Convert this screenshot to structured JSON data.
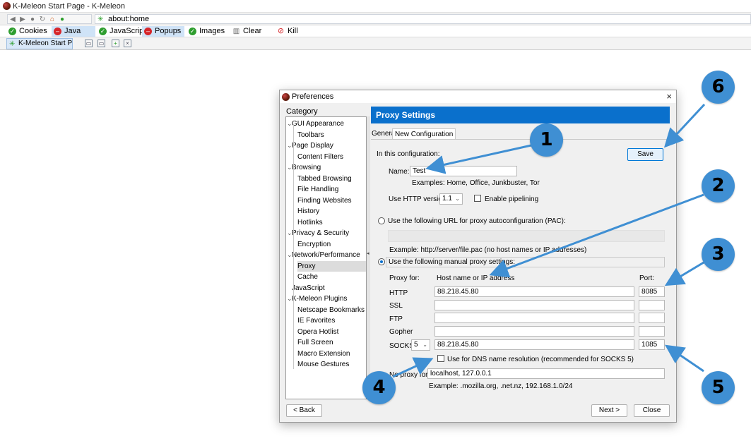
{
  "window": {
    "title": "K-Meleon Start Page - K-Meleon"
  },
  "navbar": {
    "url": "about:home"
  },
  "toggles": [
    {
      "label": "Cookies",
      "state": "on"
    },
    {
      "label": "Java",
      "state": "off"
    },
    {
      "label": "JavaScript",
      "state": "on"
    },
    {
      "label": "Popups",
      "state": "off"
    },
    {
      "label": "Images",
      "state": "on"
    },
    {
      "label": "Clear Cache",
      "state": "action"
    },
    {
      "label": "Kill Flash",
      "state": "action"
    }
  ],
  "tabs": [
    {
      "label": "K-Meleon Start Pa..."
    }
  ],
  "dialog": {
    "title": "Preferences",
    "close": "×",
    "category_label": "Category",
    "categories": [
      {
        "label": "GUI Appearance",
        "level": 0,
        "expander": true
      },
      {
        "label": "Toolbars",
        "level": 1
      },
      {
        "label": "Page Display",
        "level": 0,
        "expander": true
      },
      {
        "label": "Content Filters",
        "level": 1
      },
      {
        "label": "Browsing",
        "level": 0,
        "expander": true
      },
      {
        "label": "Tabbed Browsing",
        "level": 1
      },
      {
        "label": "File Handling",
        "level": 1
      },
      {
        "label": "Finding Websites",
        "level": 1
      },
      {
        "label": "History",
        "level": 1
      },
      {
        "label": "Hotlinks",
        "level": 1
      },
      {
        "label": "Privacy & Security",
        "level": 0,
        "expander": true
      },
      {
        "label": "Encryption",
        "level": 1
      },
      {
        "label": "Network/Performance",
        "level": 0,
        "expander": true
      },
      {
        "label": "Proxy",
        "level": 1,
        "selected": true
      },
      {
        "label": "Cache",
        "level": 1
      },
      {
        "label": "JavaScript",
        "level": 0,
        "expander": false
      },
      {
        "label": "K-Meleon Plugins",
        "level": 0,
        "expander": true
      },
      {
        "label": "Netscape Bookmarks",
        "level": 1
      },
      {
        "label": "IE Favorites",
        "level": 1
      },
      {
        "label": "Opera Hotlist",
        "level": 1
      },
      {
        "label": "Full Screen",
        "level": 1
      },
      {
        "label": "Macro Extension",
        "level": 1
      },
      {
        "label": "Mouse Gestures",
        "level": 1
      }
    ],
    "heading": "Proxy Settings",
    "subtabs": [
      {
        "label": "General"
      },
      {
        "label": "New Configuration",
        "active": true
      }
    ],
    "in_config_label": "In this configuration:",
    "save_label": "Save",
    "name_label": "Name:",
    "name_value": "Test",
    "examples_text": "Examples: Home, Office, Junkbuster, Tor",
    "http_version_label": "Use HTTP version",
    "http_version_value": "1.1",
    "pipelining_label": "Enable pipelining",
    "pac_label": "Use the following URL for proxy autoconfiguration (PAC):",
    "pac_example": "Example: http://server/file.pac (no host names or IP addresses)",
    "manual_label": "Use the following manual proxy settings:",
    "col_proxy_for": "Proxy for:",
    "col_host": "Host name or IP address",
    "col_port": "Port:",
    "rows": [
      {
        "label": "HTTP",
        "host": "88.218.45.80",
        "port": "8085"
      },
      {
        "label": "SSL",
        "host": "",
        "port": ""
      },
      {
        "label": "FTP",
        "host": "",
        "port": ""
      },
      {
        "label": "Gopher",
        "host": "",
        "port": ""
      }
    ],
    "socks": {
      "label": "SOCKS",
      "version": "5",
      "host": "88.218.45.80",
      "port": "1085"
    },
    "dns_label": "Use for DNS name resolution (recommended for SOCKS 5)",
    "no_proxy_label": "No proxy for:",
    "no_proxy_value": "localhost, 127.0.0.1",
    "no_proxy_example": "Example: .mozilla.org, .net.nz, 192.168.1.0/24",
    "back_label": "< Back",
    "next_label": "Next >",
    "close_label": "Close"
  },
  "callouts": [
    "1",
    "2",
    "3",
    "4",
    "5",
    "6"
  ],
  "colors": {
    "accent": "#0a70cc",
    "callout": "#3f8fd3"
  }
}
